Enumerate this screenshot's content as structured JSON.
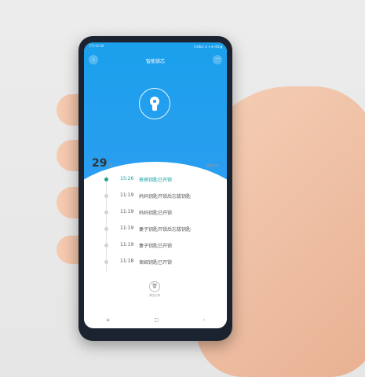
{
  "status": {
    "left": "下午12:40",
    "right": "0.6K/s ❊ ▾ ✉ HD ▮"
  },
  "app": {
    "title": "智能锁芯",
    "back_icon": "back-arrow-icon",
    "more_icon": "more-dots-icon",
    "lock_icon": "keyhole-lock-icon"
  },
  "date": {
    "day": "29",
    "month": "5月",
    "history_label": "查看历史"
  },
  "timeline": [
    {
      "time": "15:26",
      "text": "爸爸钥匙已开锁",
      "active": true
    },
    {
      "time": "11:19",
      "text": "妈妈钥匙开锁后忘拔钥匙",
      "active": false
    },
    {
      "time": "11:19",
      "text": "妈妈钥匙已开锁",
      "active": false
    },
    {
      "time": "11:19",
      "text": "妻子钥匙开锁后忘拔钥匙",
      "active": false
    },
    {
      "time": "11:19",
      "text": "妻子钥匙已开锁",
      "active": false
    },
    {
      "time": "11:18",
      "text": "保姆钥匙已开锁",
      "active": false
    }
  ],
  "clear": {
    "label": "清空记录",
    "icon": "trash-icon"
  },
  "navbar": {
    "menu": "≡",
    "home": "□",
    "back": "‹"
  },
  "colors": {
    "header": "#1aa0ec",
    "accent": "#16a1a1"
  }
}
